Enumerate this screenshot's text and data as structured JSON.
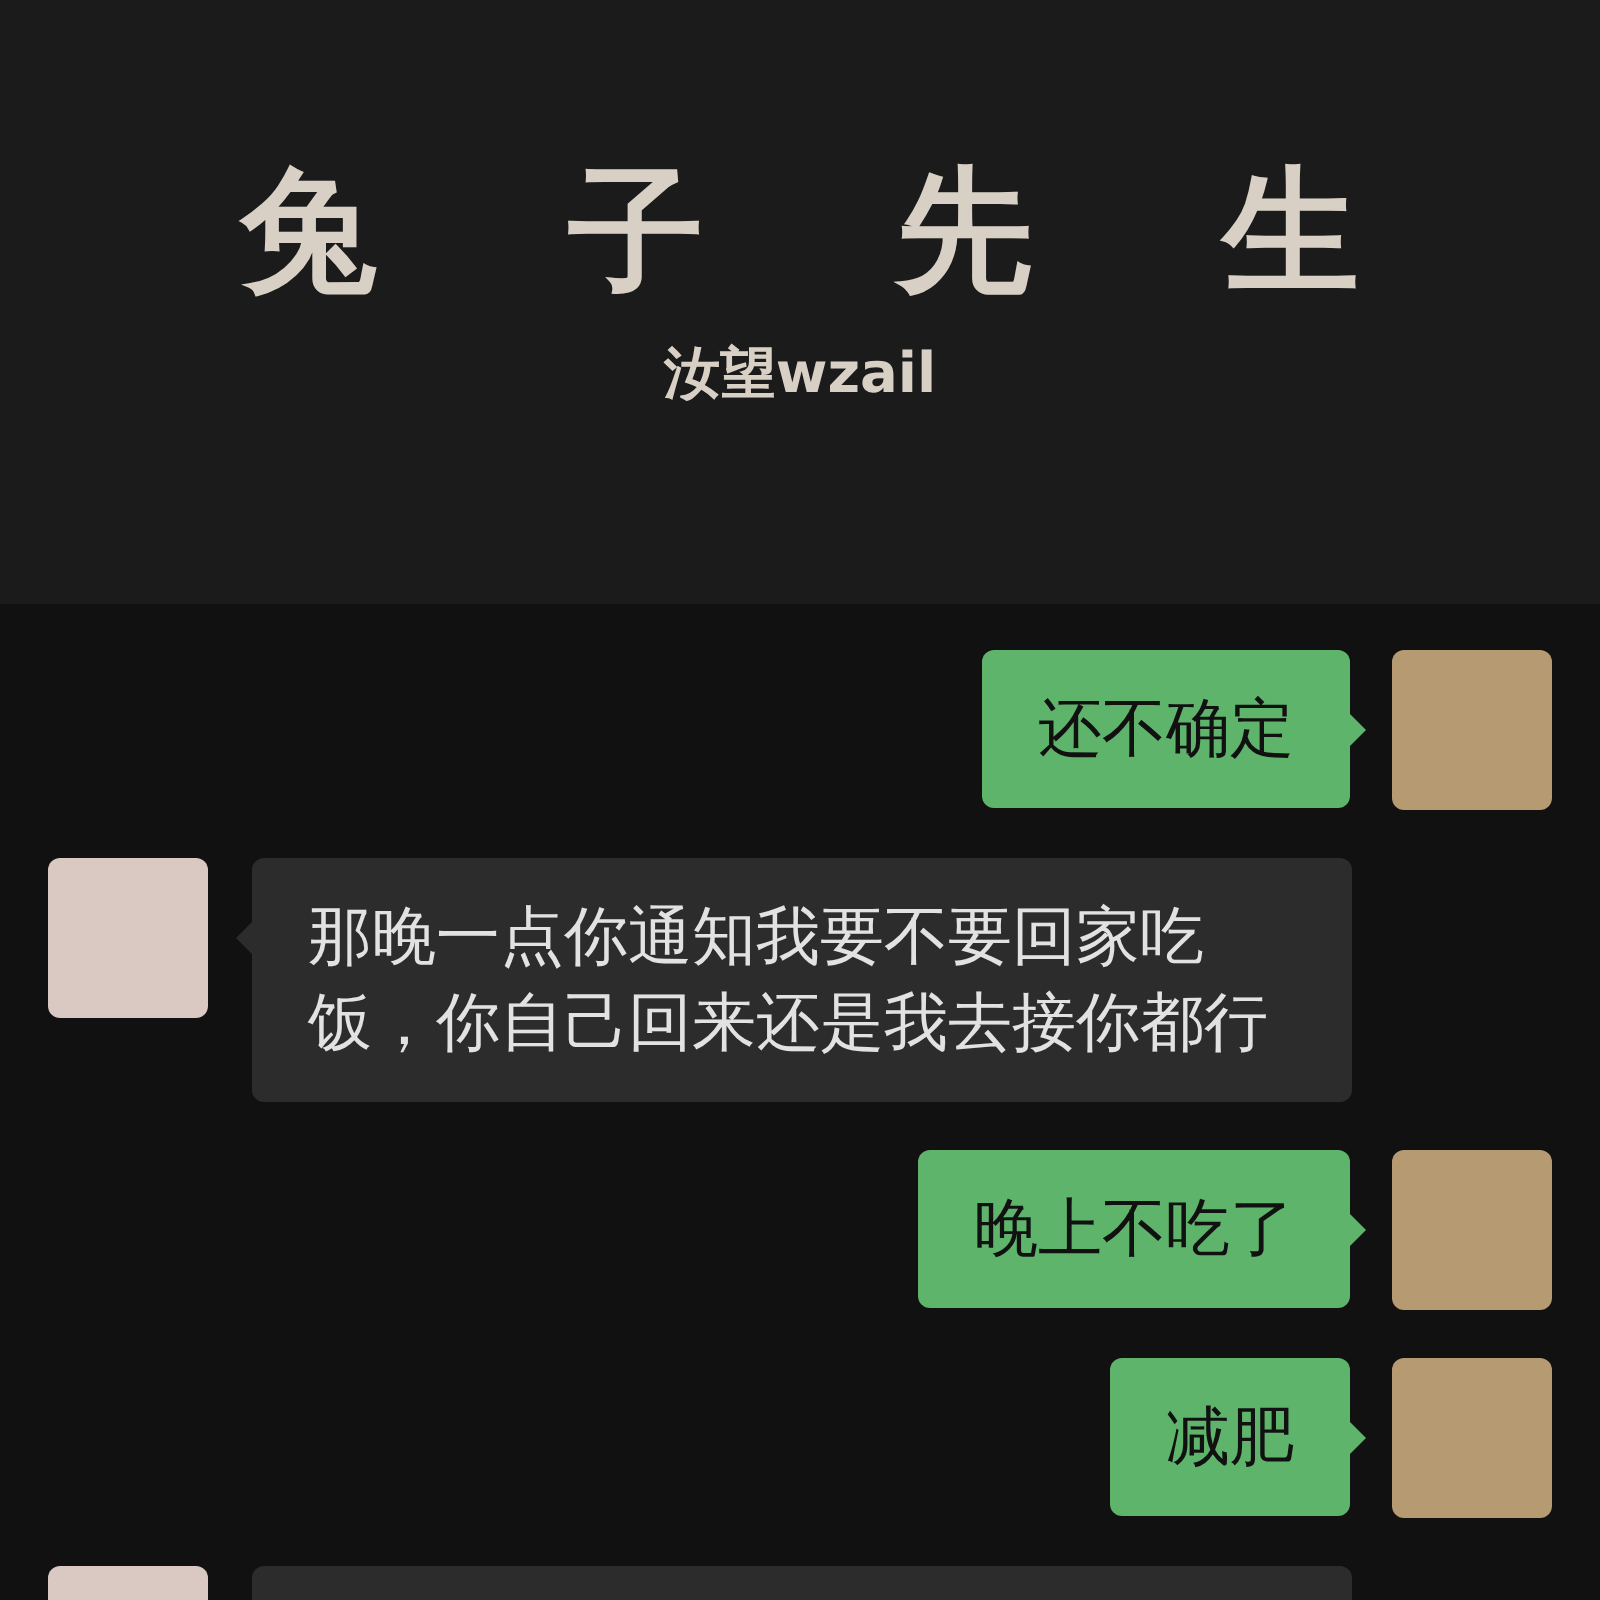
{
  "header": {
    "title": "兔 子 先 生",
    "subtitle": "汝望wzail"
  },
  "messages": [
    {
      "kind": "sent",
      "text": "还不确定"
    },
    {
      "kind": "received",
      "text": "那晚一点你通知我要不要回家吃饭，你自己回来还是我去接你都行"
    },
    {
      "kind": "sent",
      "text": "晚上不吃了"
    },
    {
      "kind": "sent",
      "text": "减肥"
    },
    {
      "kind": "received"
    }
  ]
}
